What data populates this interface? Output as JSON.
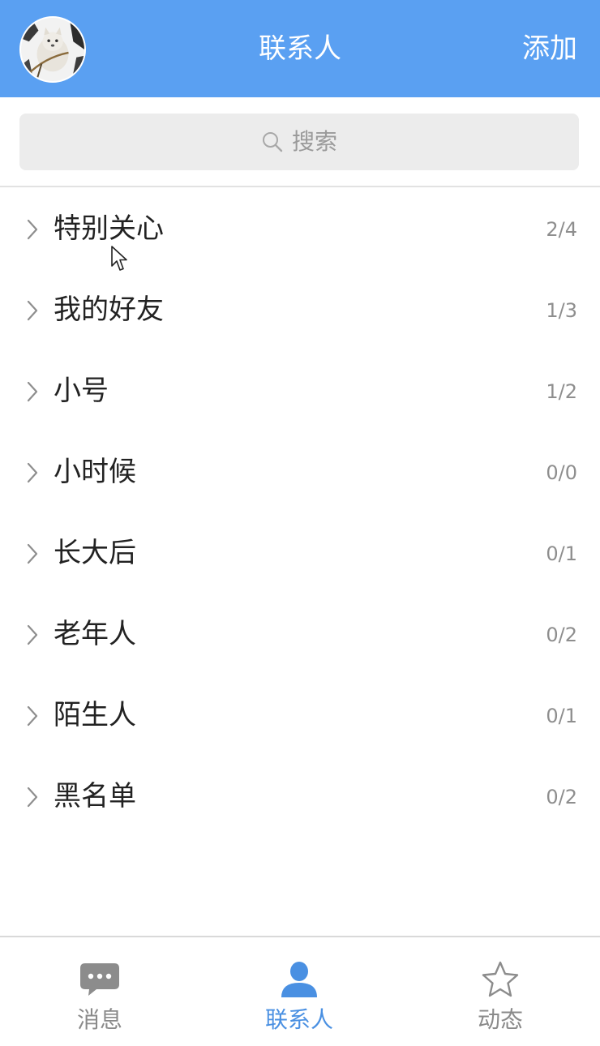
{
  "header": {
    "title": "联系人",
    "add_label": "添加"
  },
  "search": {
    "placeholder": "搜索"
  },
  "groups": [
    {
      "name": "特别关心",
      "count": "2/4"
    },
    {
      "name": "我的好友",
      "count": "1/3"
    },
    {
      "name": "小号",
      "count": "1/2"
    },
    {
      "name": "小时候",
      "count": "0/0"
    },
    {
      "name": "长大后",
      "count": "0/1"
    },
    {
      "name": "老年人",
      "count": "0/2"
    },
    {
      "name": "陌生人",
      "count": "0/1"
    },
    {
      "name": "黑名单",
      "count": "0/2"
    }
  ],
  "tabbar": {
    "active": "contacts",
    "tabs": [
      {
        "id": "messages",
        "label": "消息",
        "icon": "message-bubble-icon"
      },
      {
        "id": "contacts",
        "label": "联系人",
        "icon": "person-icon"
      },
      {
        "id": "moments",
        "label": "动态",
        "icon": "star-icon"
      }
    ]
  },
  "colors": {
    "header_bg": "#5aa0f2",
    "active_tab": "#4a90e2",
    "inactive_tab": "#8a8a8a"
  }
}
